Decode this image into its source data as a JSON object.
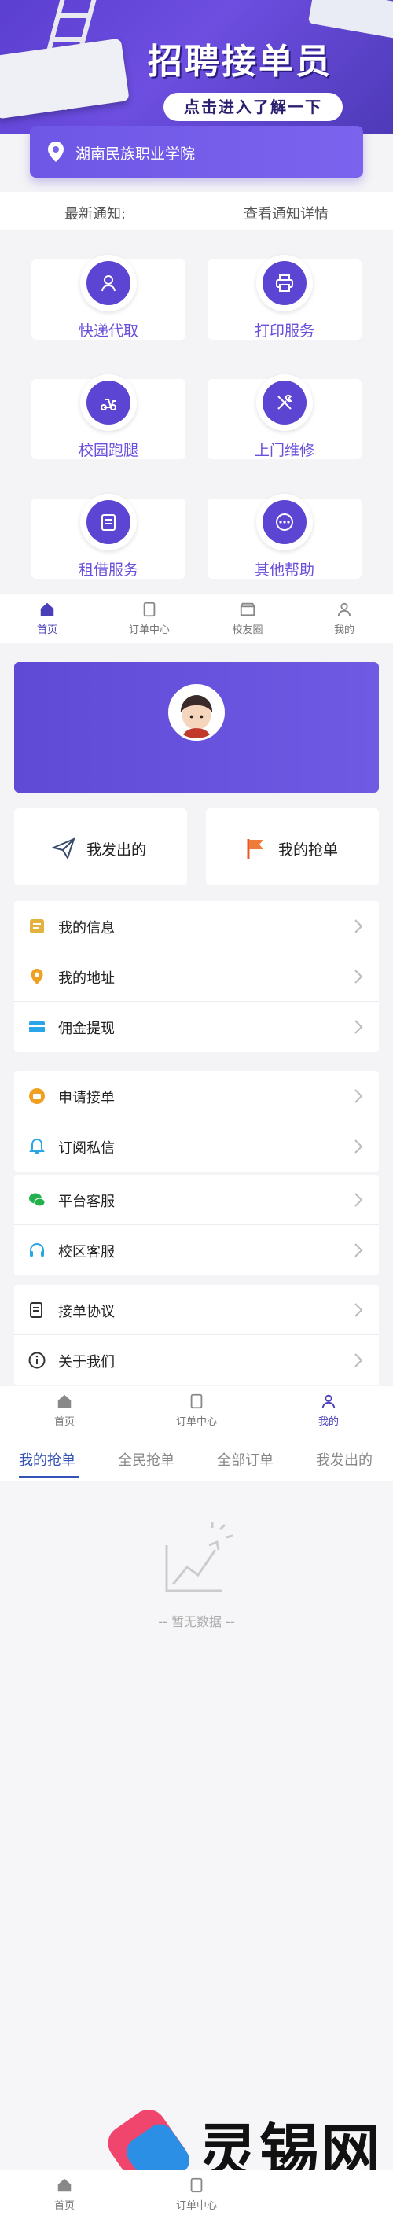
{
  "banner": {
    "title": "招聘接单员",
    "subtitle": "点击进入了解一下"
  },
  "school": {
    "name": "湖南民族职业学院"
  },
  "notice": {
    "label": "最新通知:",
    "link": "查看通知详情"
  },
  "services": [
    {
      "label": "快递代取",
      "icon": "courier-icon"
    },
    {
      "label": "打印服务",
      "icon": "printer-icon"
    },
    {
      "label": "校园跑腿",
      "icon": "scooter-icon"
    },
    {
      "label": "上门维修",
      "icon": "wrench-icon"
    },
    {
      "label": "租借服务",
      "icon": "rent-icon"
    },
    {
      "label": "其他帮助",
      "icon": "more-icon"
    }
  ],
  "tabbar_home": [
    {
      "label": "首页",
      "icon": "home-icon"
    },
    {
      "label": "订单中心",
      "icon": "orders-icon"
    },
    {
      "label": "校友圈",
      "icon": "shop-icon"
    },
    {
      "label": "我的",
      "icon": "user-icon"
    }
  ],
  "profile": {
    "quick": [
      {
        "label": "我发出的",
        "icon": "paper-plane-icon"
      },
      {
        "label": "我的抢单",
        "icon": "flag-icon"
      }
    ],
    "group1": [
      {
        "label": "我的信息",
        "icon": "info-card-icon",
        "color": "#e3b23c"
      },
      {
        "label": "我的地址",
        "icon": "location-icon",
        "color": "#f0a020"
      },
      {
        "label": "佣金提现",
        "icon": "card-icon",
        "color": "#2aa6e8"
      }
    ],
    "group2": [
      {
        "label": "申请接单",
        "icon": "apply-icon",
        "color": "#f0a020"
      },
      {
        "label": "订阅私信",
        "icon": "bell-icon",
        "color": "#2aa6e8"
      }
    ],
    "group3": [
      {
        "label": "平台客服",
        "icon": "wechat-icon",
        "color": "#23b14d"
      },
      {
        "label": "校区客服",
        "icon": "headset-icon",
        "color": "#2aa6e8"
      }
    ],
    "group4": [
      {
        "label": "接单协议",
        "icon": "document-icon",
        "color": "#333333"
      },
      {
        "label": "关于我们",
        "icon": "about-icon",
        "color": "#333333"
      }
    ]
  },
  "tabbar_profile": [
    {
      "label": "首页",
      "icon": "home-icon"
    },
    {
      "label": "订单中心",
      "icon": "orders-icon"
    },
    {
      "label": "我的",
      "icon": "user-icon"
    }
  ],
  "orders": {
    "tabs": [
      "我的抢单",
      "全民抢单",
      "全部订单",
      "我发出的"
    ],
    "empty": "-- 暂无数据 --"
  },
  "tabbar_orders": [
    {
      "label": "首页",
      "icon": "home-icon"
    },
    {
      "label": "订单中心",
      "icon": "orders-icon"
    }
  ],
  "watermark": {
    "text": "灵锡网"
  },
  "colors": {
    "primary": "#5b45d2",
    "tab_active": "#4a3fb8",
    "order_active": "#3552b8"
  }
}
